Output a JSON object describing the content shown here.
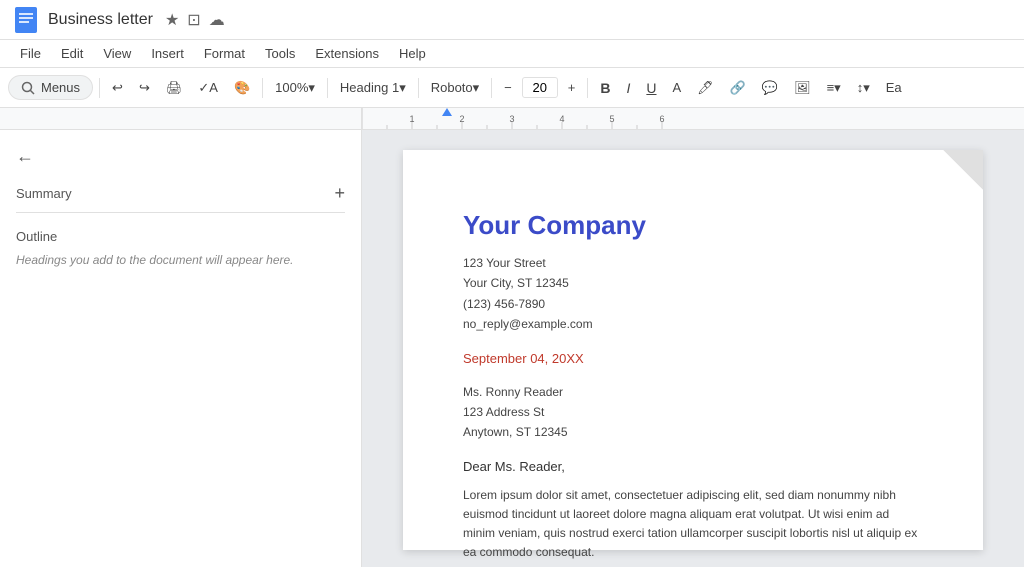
{
  "titlebar": {
    "doc_title": "Business letter",
    "star_icon": "★",
    "folder_icon": "⊡",
    "cloud_icon": "☁"
  },
  "menubar": {
    "items": [
      "File",
      "Edit",
      "View",
      "Insert",
      "Format",
      "Tools",
      "Extensions",
      "Help"
    ]
  },
  "toolbar": {
    "search_label": "Menus",
    "zoom_value": "100%",
    "heading_style": "Heading 1",
    "font_family": "Roboto",
    "font_size": "20",
    "bold_label": "B",
    "italic_label": "I",
    "underline_label": "U",
    "ea_label": "Ea"
  },
  "sidebar": {
    "back_icon": "←",
    "summary_label": "Summary",
    "add_icon": "+",
    "outline_label": "Outline",
    "outline_hint": "Headings you add to the document will appear here."
  },
  "document": {
    "company_name": "Your Company",
    "address_line1": "123 Your Street",
    "address_line2": "Your City, ST 12345",
    "address_line3": "(123) 456-7890",
    "address_line4": "no_reply@example.com",
    "date": "September 04, 20XX",
    "recipient_name": "Ms. Ronny Reader",
    "recipient_addr1": "123 Address St",
    "recipient_addr2": "Anytown, ST 12345",
    "salutation": "Dear Ms. Reader,",
    "body_text": "Lorem ipsum dolor sit amet, consectetuer adipiscing elit, sed diam nonummy nibh euismod tincidunt ut laoreet dolore magna aliquam erat volutpat. Ut wisi enim ad minim veniam, quis nostrud exerci tation ullamcorper suscipit lobortis nisl ut aliquip ex ea commodo consequat."
  }
}
